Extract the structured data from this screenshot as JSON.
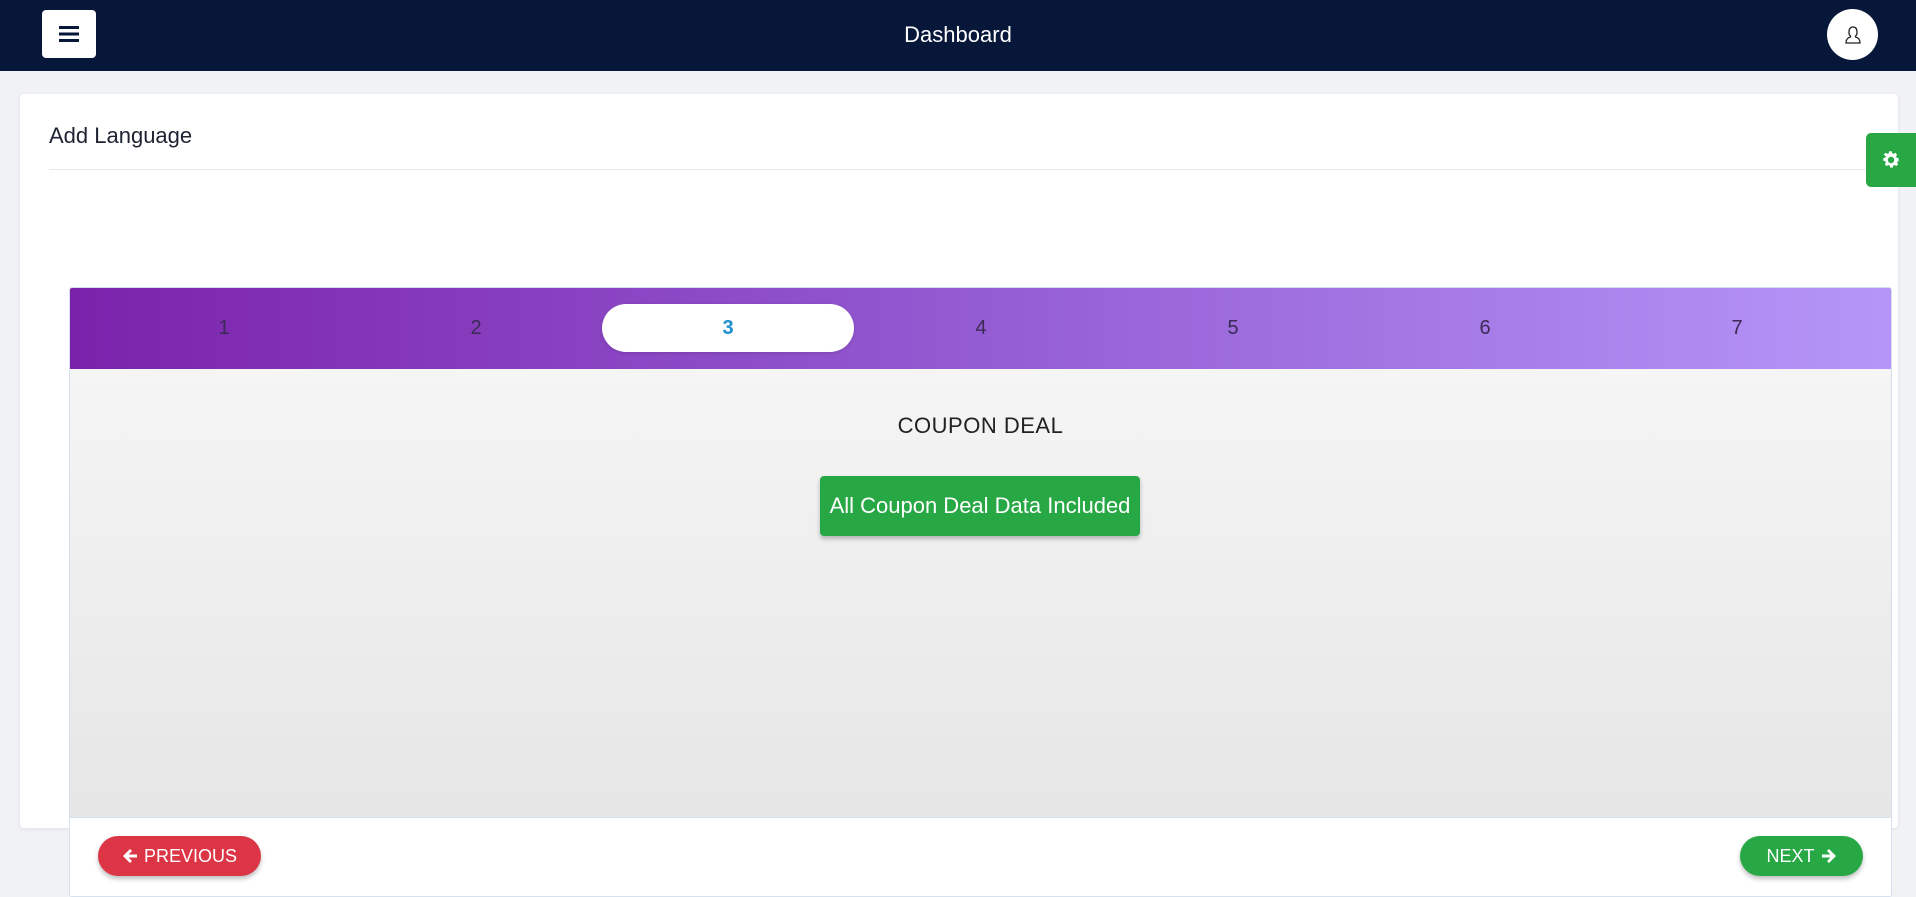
{
  "header": {
    "title": "Dashboard",
    "menu_icon": "hamburger-menu-icon",
    "user_icon": "user-icon"
  },
  "card": {
    "title": "Add Language"
  },
  "settings": {
    "icon": "gear-icon",
    "color": "#28a745"
  },
  "wizard": {
    "steps": [
      "1",
      "2",
      "3",
      "4",
      "5",
      "6",
      "7"
    ],
    "active_step": "3",
    "section_title": "COUPON DEAL",
    "included_label": "All Coupon Deal Data Included",
    "previous_label": "PREVIOUS",
    "next_label": "NEXT"
  },
  "colors": {
    "topbar": "#06173a",
    "gradient_start": "#7b22ab",
    "gradient_end": "#b596f8",
    "success": "#28a745",
    "danger": "#dc3545",
    "active_step_text": "#1f8fd0"
  }
}
